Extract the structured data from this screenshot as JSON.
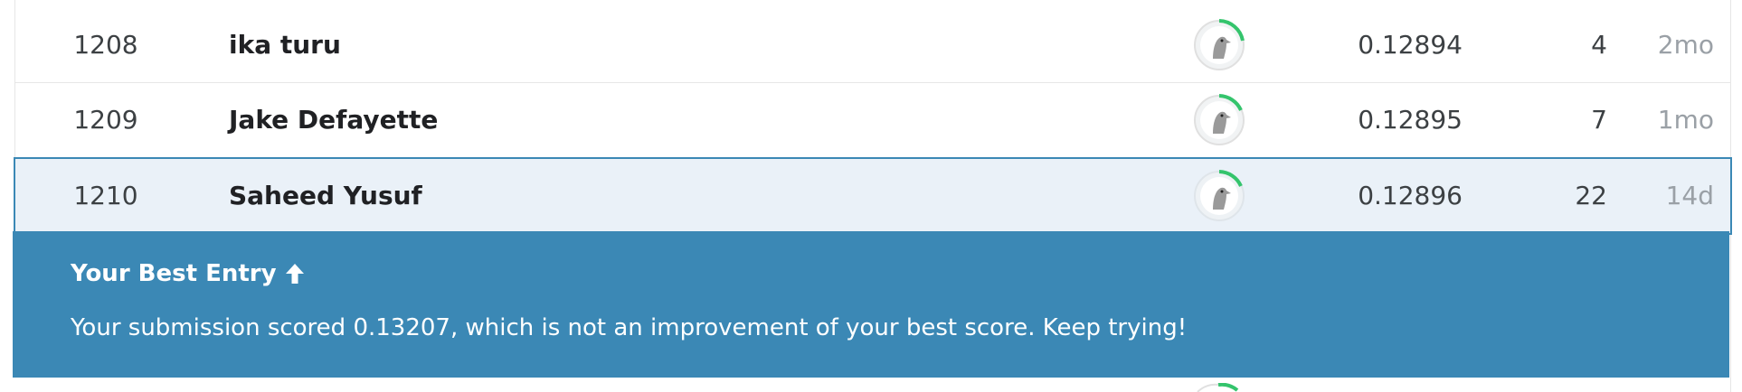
{
  "leaderboard": {
    "rows": [
      {
        "rank": "1208",
        "name": "ika turu",
        "score": "0.12894",
        "entries": "4",
        "last": "2mo"
      },
      {
        "rank": "1209",
        "name": "Jake Defayette",
        "score": "0.12895",
        "entries": "7",
        "last": "1mo"
      },
      {
        "rank": "1210",
        "name": "Saheed Yusuf",
        "score": "0.12896",
        "entries": "22",
        "last": "14d"
      }
    ]
  },
  "banner": {
    "title": "Your Best Entry",
    "title_icon": "arrow-up-icon",
    "message": "Your submission scored 0.13207, which is not an improvement of your best score. Keep trying!"
  },
  "colors": {
    "accent": "#3b88b5",
    "highlight_row": "#eaf1f8",
    "progress_ring": "#34c46c"
  },
  "icons": {
    "avatar": "bird-avatar-icon"
  }
}
